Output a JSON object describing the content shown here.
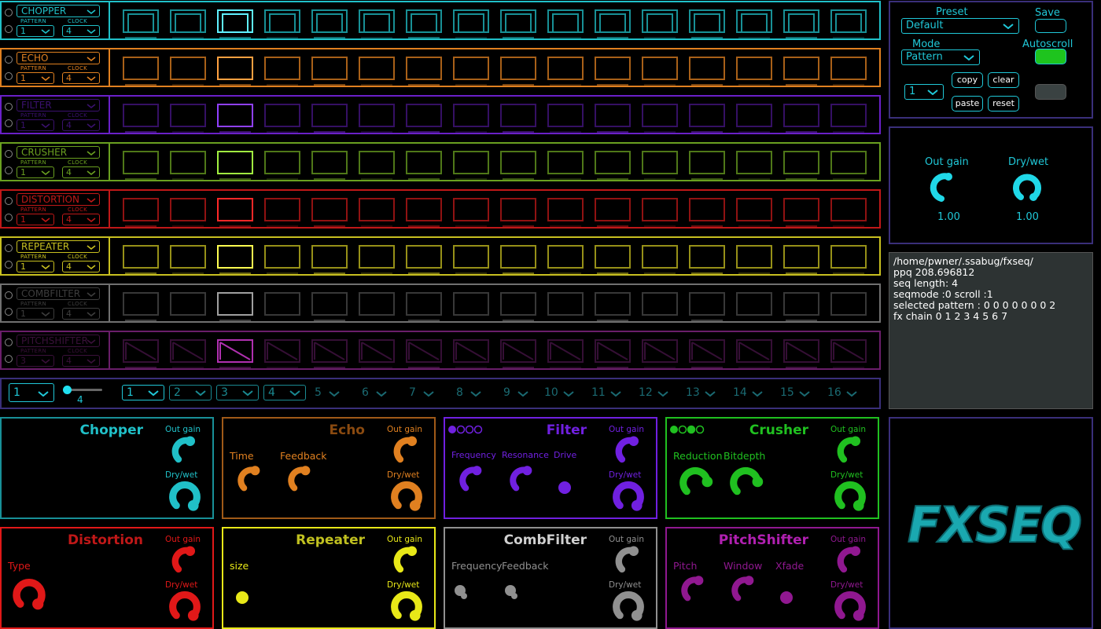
{
  "sequencer": {
    "lanes": [
      {
        "name": "CHOPPER",
        "color": "#20c0c8",
        "active": "#5ff0ff",
        "pattern": "1",
        "clock": "4",
        "shape": "square"
      },
      {
        "name": "ECHO",
        "color": "#e08020",
        "active": "#ffa040",
        "pattern": "1",
        "clock": "4",
        "shape": "plain"
      },
      {
        "name": "FILTER",
        "color": "#6a20c8",
        "active": "#9040ff",
        "pattern": "1",
        "clock": "4",
        "shape": "plain",
        "dim": true
      },
      {
        "name": "CRUSHER",
        "color": "#6aa020",
        "active": "#a0f040",
        "pattern": "1",
        "clock": "4",
        "shape": "plain"
      },
      {
        "name": "DISTORTION",
        "color": "#c01818",
        "active": "#ff2828",
        "pattern": "1",
        "clock": "4",
        "shape": "plain"
      },
      {
        "name": "REPEATER",
        "color": "#c8c020",
        "active": "#ffff50",
        "pattern": "1",
        "clock": "4",
        "shape": "plain"
      },
      {
        "name": "COMBFILTER",
        "color": "#707070",
        "active": "#a0a0a0",
        "pattern": "1",
        "clock": "4",
        "shape": "plain",
        "dim": true
      },
      {
        "name": "PITCHSHIFTER",
        "color": "#6a1e6a",
        "active": "#b030b0",
        "pattern": "3",
        "clock": "4",
        "shape": "diag",
        "dim": true
      }
    ],
    "pattern_label": "PATTERN",
    "clock_label": "CLOCK",
    "steps_per_lane": 16,
    "active_step": 3,
    "bottom": {
      "length_select": "1",
      "slider_value": "4",
      "patterns": [
        "1",
        "2",
        "3",
        "4",
        "5",
        "6",
        "7",
        "8",
        "9",
        "10",
        "11",
        "12",
        "13",
        "14",
        "15",
        "16"
      ]
    }
  },
  "controls": {
    "preset_label": "Preset",
    "preset_value": "Default",
    "save_label": "Save",
    "mode_label": "Mode",
    "mode_value": "Pattern",
    "autoscroll_label": "Autoscroll",
    "page_select": "1",
    "copy": "copy",
    "clear": "clear",
    "paste": "paste",
    "reset": "reset"
  },
  "master": {
    "out_gain_label": "Out gain",
    "out_gain_value": "1.00",
    "drywet_label": "Dry/wet",
    "drywet_value": "1.00"
  },
  "info": {
    "lines": [
      "/home/pwner/.ssabug/fxseq/",
      "ppq 208.696812",
      "seq length: 4",
      "seqmode :0 scroll :1",
      "selected pattern :  0 0 0 0 0 0 0 2",
      "fx chain  0 1 2 3 4 5 6 7"
    ]
  },
  "modules": [
    {
      "title": "Chopper",
      "color": "#20c0c8",
      "params": []
    },
    {
      "title": "Echo",
      "color": "#e08020",
      "titleColor": "#8a4a10",
      "params": [
        "Time",
        "Feedback"
      ]
    },
    {
      "title": "Filter",
      "color": "#7020e0",
      "params": [
        "Frequency",
        "Resonance",
        "Drive"
      ]
    },
    {
      "title": "Crusher",
      "color": "#20c020",
      "params": [
        "Reduction",
        "Bitdepth"
      ]
    },
    {
      "title": "Distortion",
      "color": "#e01818",
      "titleColor": "#c01818",
      "params": [
        "Type"
      ]
    },
    {
      "title": "Repeater",
      "color": "#e8e818",
      "titleColor": "#c0c020",
      "params": [
        "size"
      ]
    },
    {
      "title": "CombFilter",
      "color": "#909090",
      "titleColor": "#d0d0d0",
      "params": [
        "Frequency",
        "Feedback"
      ]
    },
    {
      "title": "PitchShifter",
      "color": "#901890",
      "titleColor": "#b020b0",
      "params": [
        "Pitch",
        "Window",
        "Xfade"
      ]
    }
  ],
  "module_out_gain": "Out gain",
  "module_drywet": "Dry/wet",
  "logo_text": "FXSEQ"
}
